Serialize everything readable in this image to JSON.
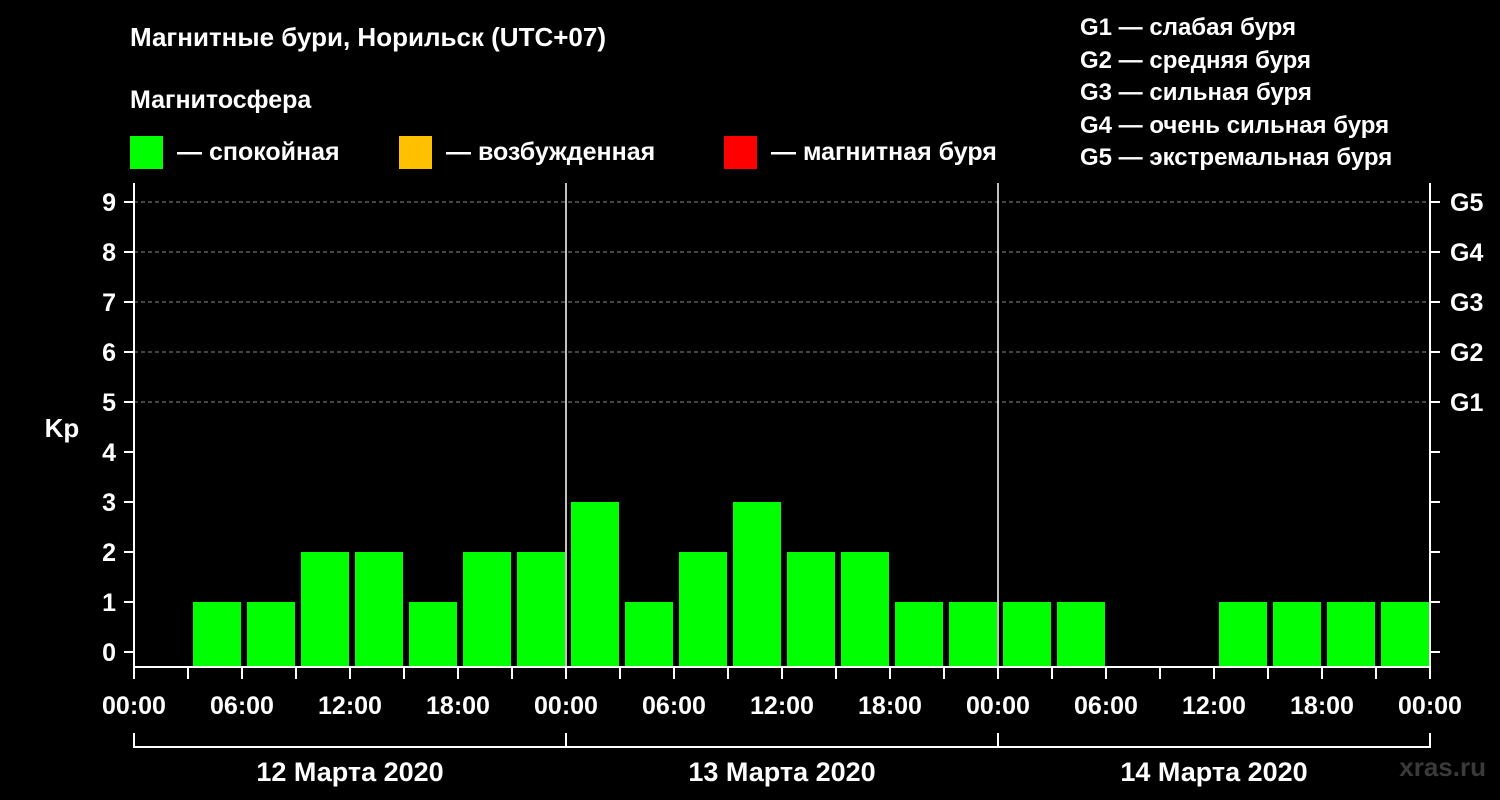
{
  "chart_data": {
    "type": "bar",
    "title": "Магнитные бури, Норильск (UTC+07)",
    "subtitle": "Магнитосфера",
    "ylabel": "Kp",
    "ylim": [
      0,
      9
    ],
    "yticks": [
      "0",
      "1",
      "2",
      "3",
      "4",
      "5",
      "6",
      "7",
      "8",
      "9"
    ],
    "right_labels": [
      {
        "kp": 5,
        "label": "G1"
      },
      {
        "kp": 6,
        "label": "G2"
      },
      {
        "kp": 7,
        "label": "G3"
      },
      {
        "kp": 8,
        "label": "G4"
      },
      {
        "kp": 9,
        "label": "G5"
      }
    ],
    "xticks": [
      "00:00",
      "06:00",
      "12:00",
      "18:00",
      "00:00",
      "06:00",
      "12:00",
      "18:00",
      "00:00",
      "06:00",
      "12:00",
      "18:00",
      "00:00"
    ],
    "days": [
      "12 Марта 2020",
      "13 Марта 2020",
      "14 Марта 2020"
    ],
    "interval_hours": 3,
    "values": [
      0,
      1,
      1,
      2,
      2,
      1,
      2,
      2,
      3,
      1,
      2,
      3,
      2,
      2,
      1,
      1,
      1,
      1,
      0,
      0,
      1,
      1,
      1,
      1
    ],
    "grid": true,
    "colors": {
      "quiet": "#00ff00",
      "excited": "#ffc000",
      "storm": "#ff0000",
      "grid": "#888888",
      "axis": "#ffffff"
    }
  },
  "legend": {
    "quiet": "— спокойная",
    "excited": "— возбужденная",
    "storm": "— магнитная буря"
  },
  "g_legend": [
    "G1 — слабая буря",
    "G2 — средняя буря",
    "G3 — сильная буря",
    "G4 — очень сильная буря",
    "G5 — экстремальная буря"
  ],
  "watermark": "xras.ru"
}
